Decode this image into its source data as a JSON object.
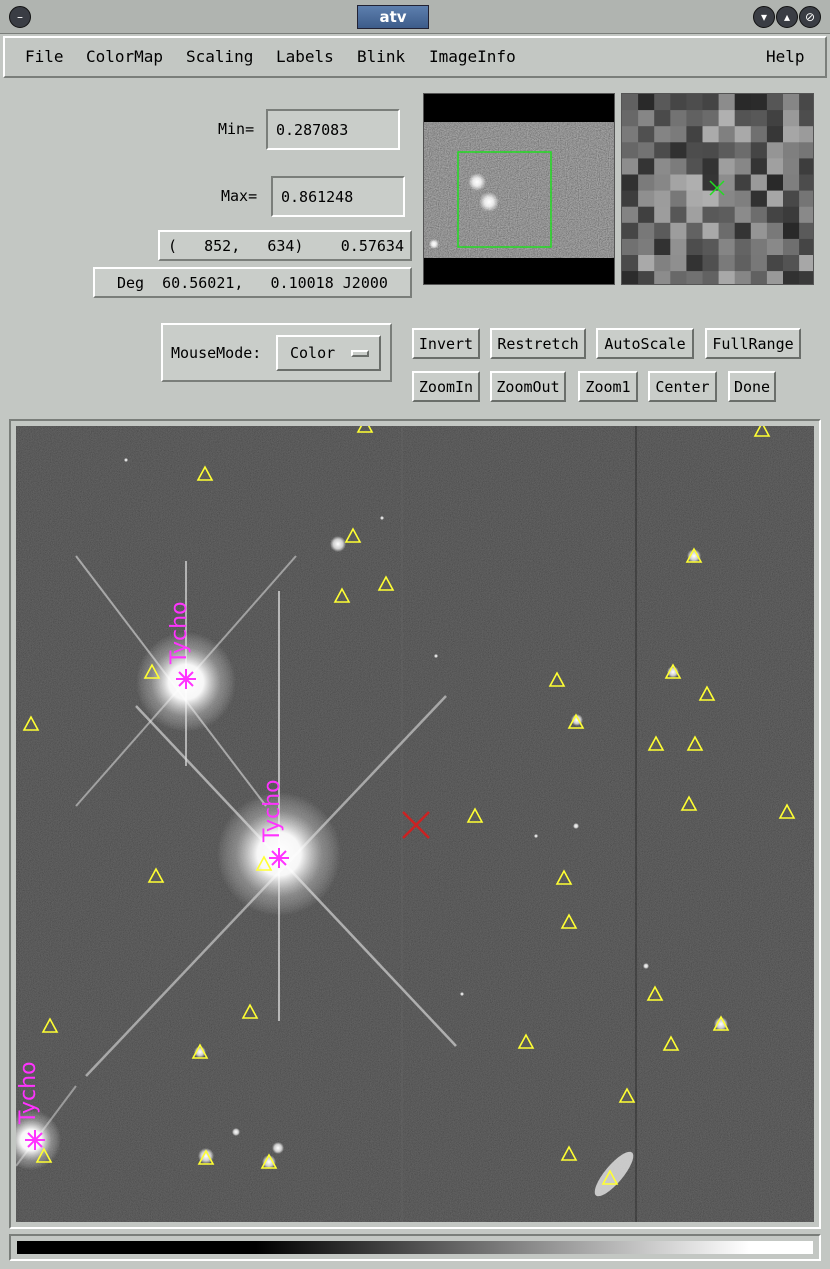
{
  "window": {
    "title": "atv"
  },
  "menu": [
    "File",
    "ColorMap",
    "Scaling",
    "Labels",
    "Blink",
    "ImageInfo",
    "Help"
  ],
  "scale": {
    "min_label": "Min=",
    "min_value": "0.287083",
    "max_label": "Max=",
    "max_value": "0.861248"
  },
  "readout": {
    "pixel": "(   852,   634)",
    "value": "0.57634",
    "coords": "Deg  60.56021,   0.10018 J2000"
  },
  "mousemode": {
    "label": "MouseMode:",
    "value": "Color"
  },
  "buttons": {
    "row1": [
      "Invert",
      "Restretch",
      "AutoScale",
      "FullRange"
    ],
    "row2": [
      "ZoomIn",
      "ZoomOut",
      "Zoom1",
      "Center",
      "Done"
    ]
  },
  "overlay": {
    "label_text": "Tycho",
    "marker_color": "#ffff33",
    "label_color": "#ff33ff",
    "cursor_color": "#cc2222",
    "pan_box_color": "#22dd22"
  },
  "icons": {
    "window_menu": "window-menu-icon",
    "minimize": "minimize-icon",
    "maximize": "maximize-icon",
    "close": "close-icon",
    "dropdown": "dropdown-icon"
  }
}
